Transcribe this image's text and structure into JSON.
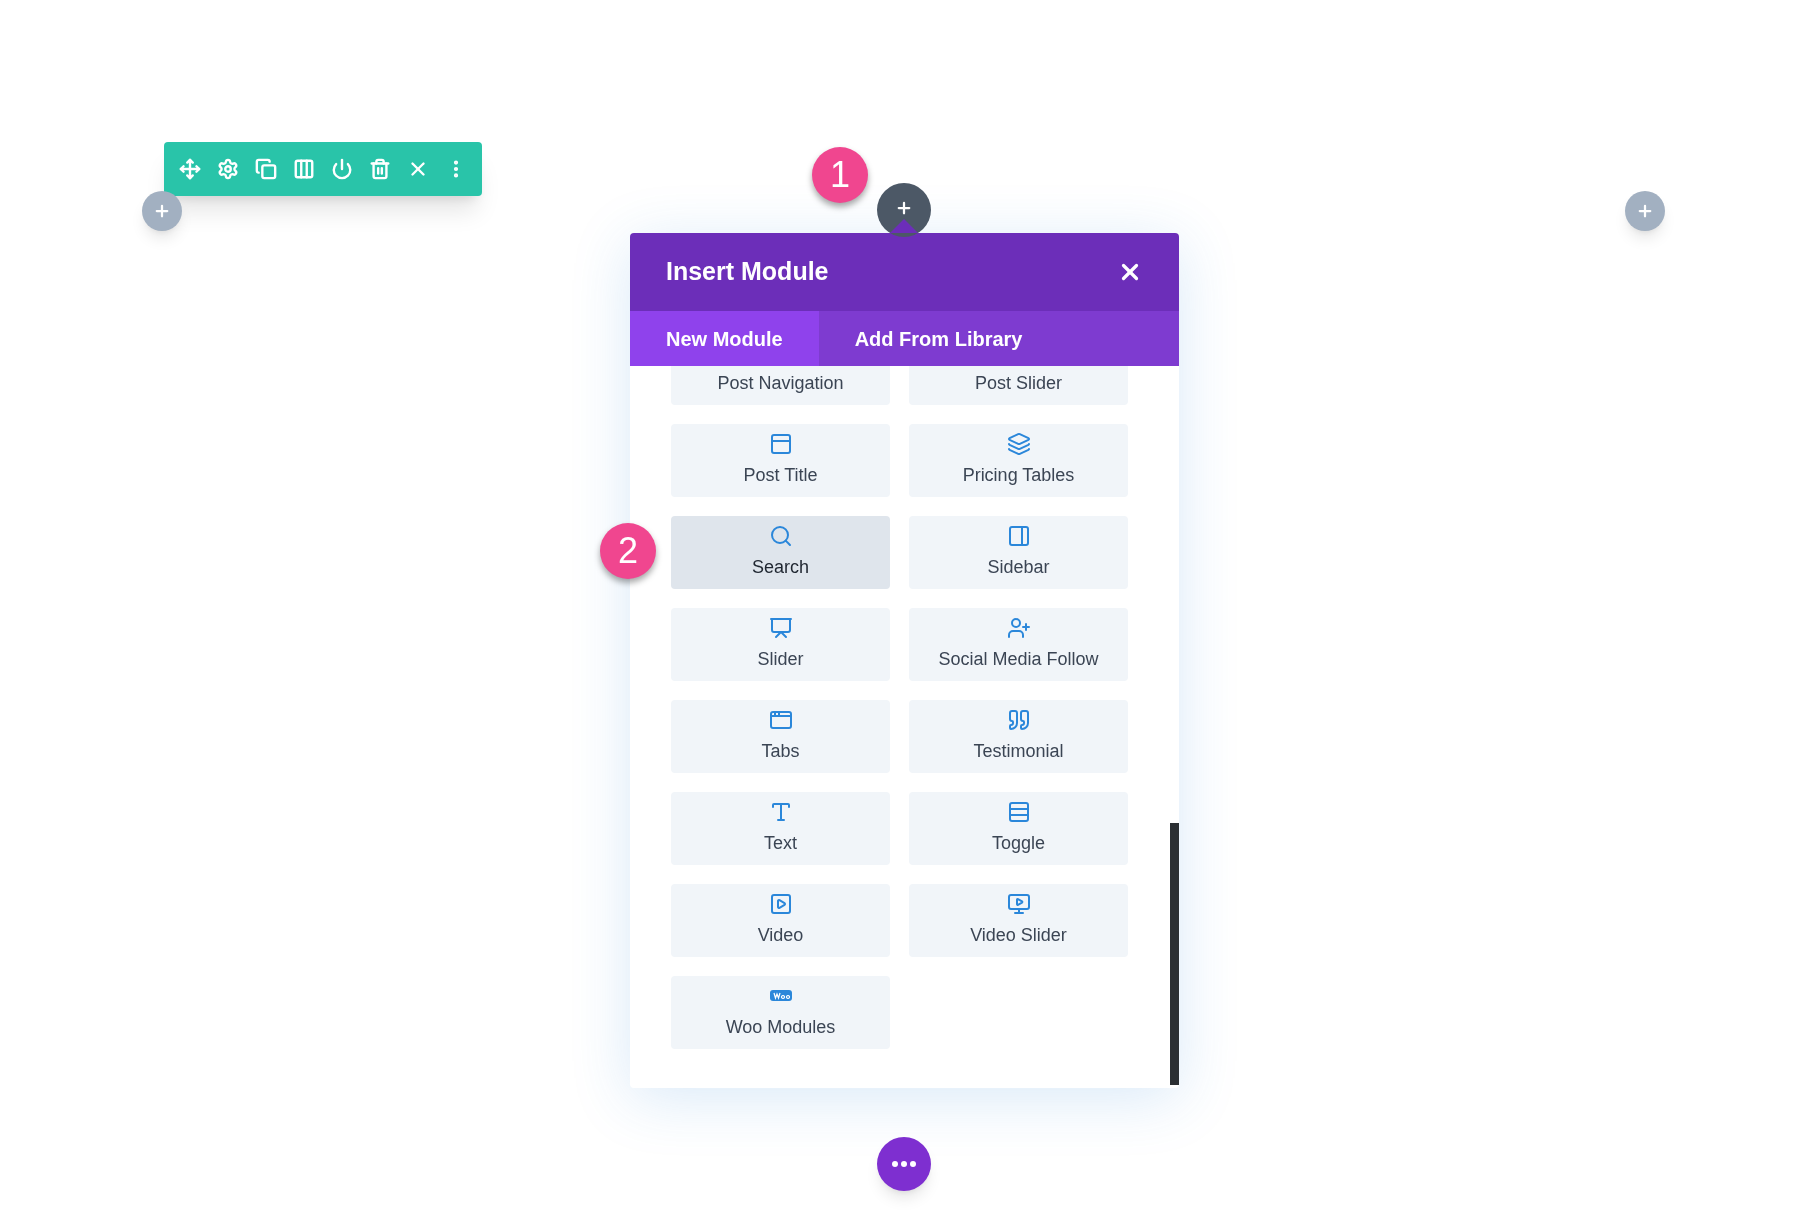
{
  "callouts": [
    {
      "label": "1"
    },
    {
      "label": "2"
    }
  ],
  "modal": {
    "title": "Insert Module",
    "tabs": [
      {
        "label": "New Module",
        "selected": true
      },
      {
        "label": "Add From Library",
        "selected": false
      }
    ],
    "modules": [
      {
        "label": "Post Navigation",
        "selected": false
      },
      {
        "label": "Post Slider",
        "selected": false
      },
      {
        "label": "Post Title",
        "selected": false
      },
      {
        "label": "Pricing Tables",
        "selected": false
      },
      {
        "label": "Search",
        "selected": true
      },
      {
        "label": "Sidebar",
        "selected": false
      },
      {
        "label": "Slider",
        "selected": false
      },
      {
        "label": "Social Media Follow",
        "selected": false
      },
      {
        "label": "Tabs",
        "selected": false
      },
      {
        "label": "Testimonial",
        "selected": false
      },
      {
        "label": "Text",
        "selected": false
      },
      {
        "label": "Toggle",
        "selected": false
      },
      {
        "label": "Video",
        "selected": false
      },
      {
        "label": "Video Slider",
        "selected": false
      },
      {
        "label": "Woo Modules",
        "selected": false
      }
    ]
  }
}
